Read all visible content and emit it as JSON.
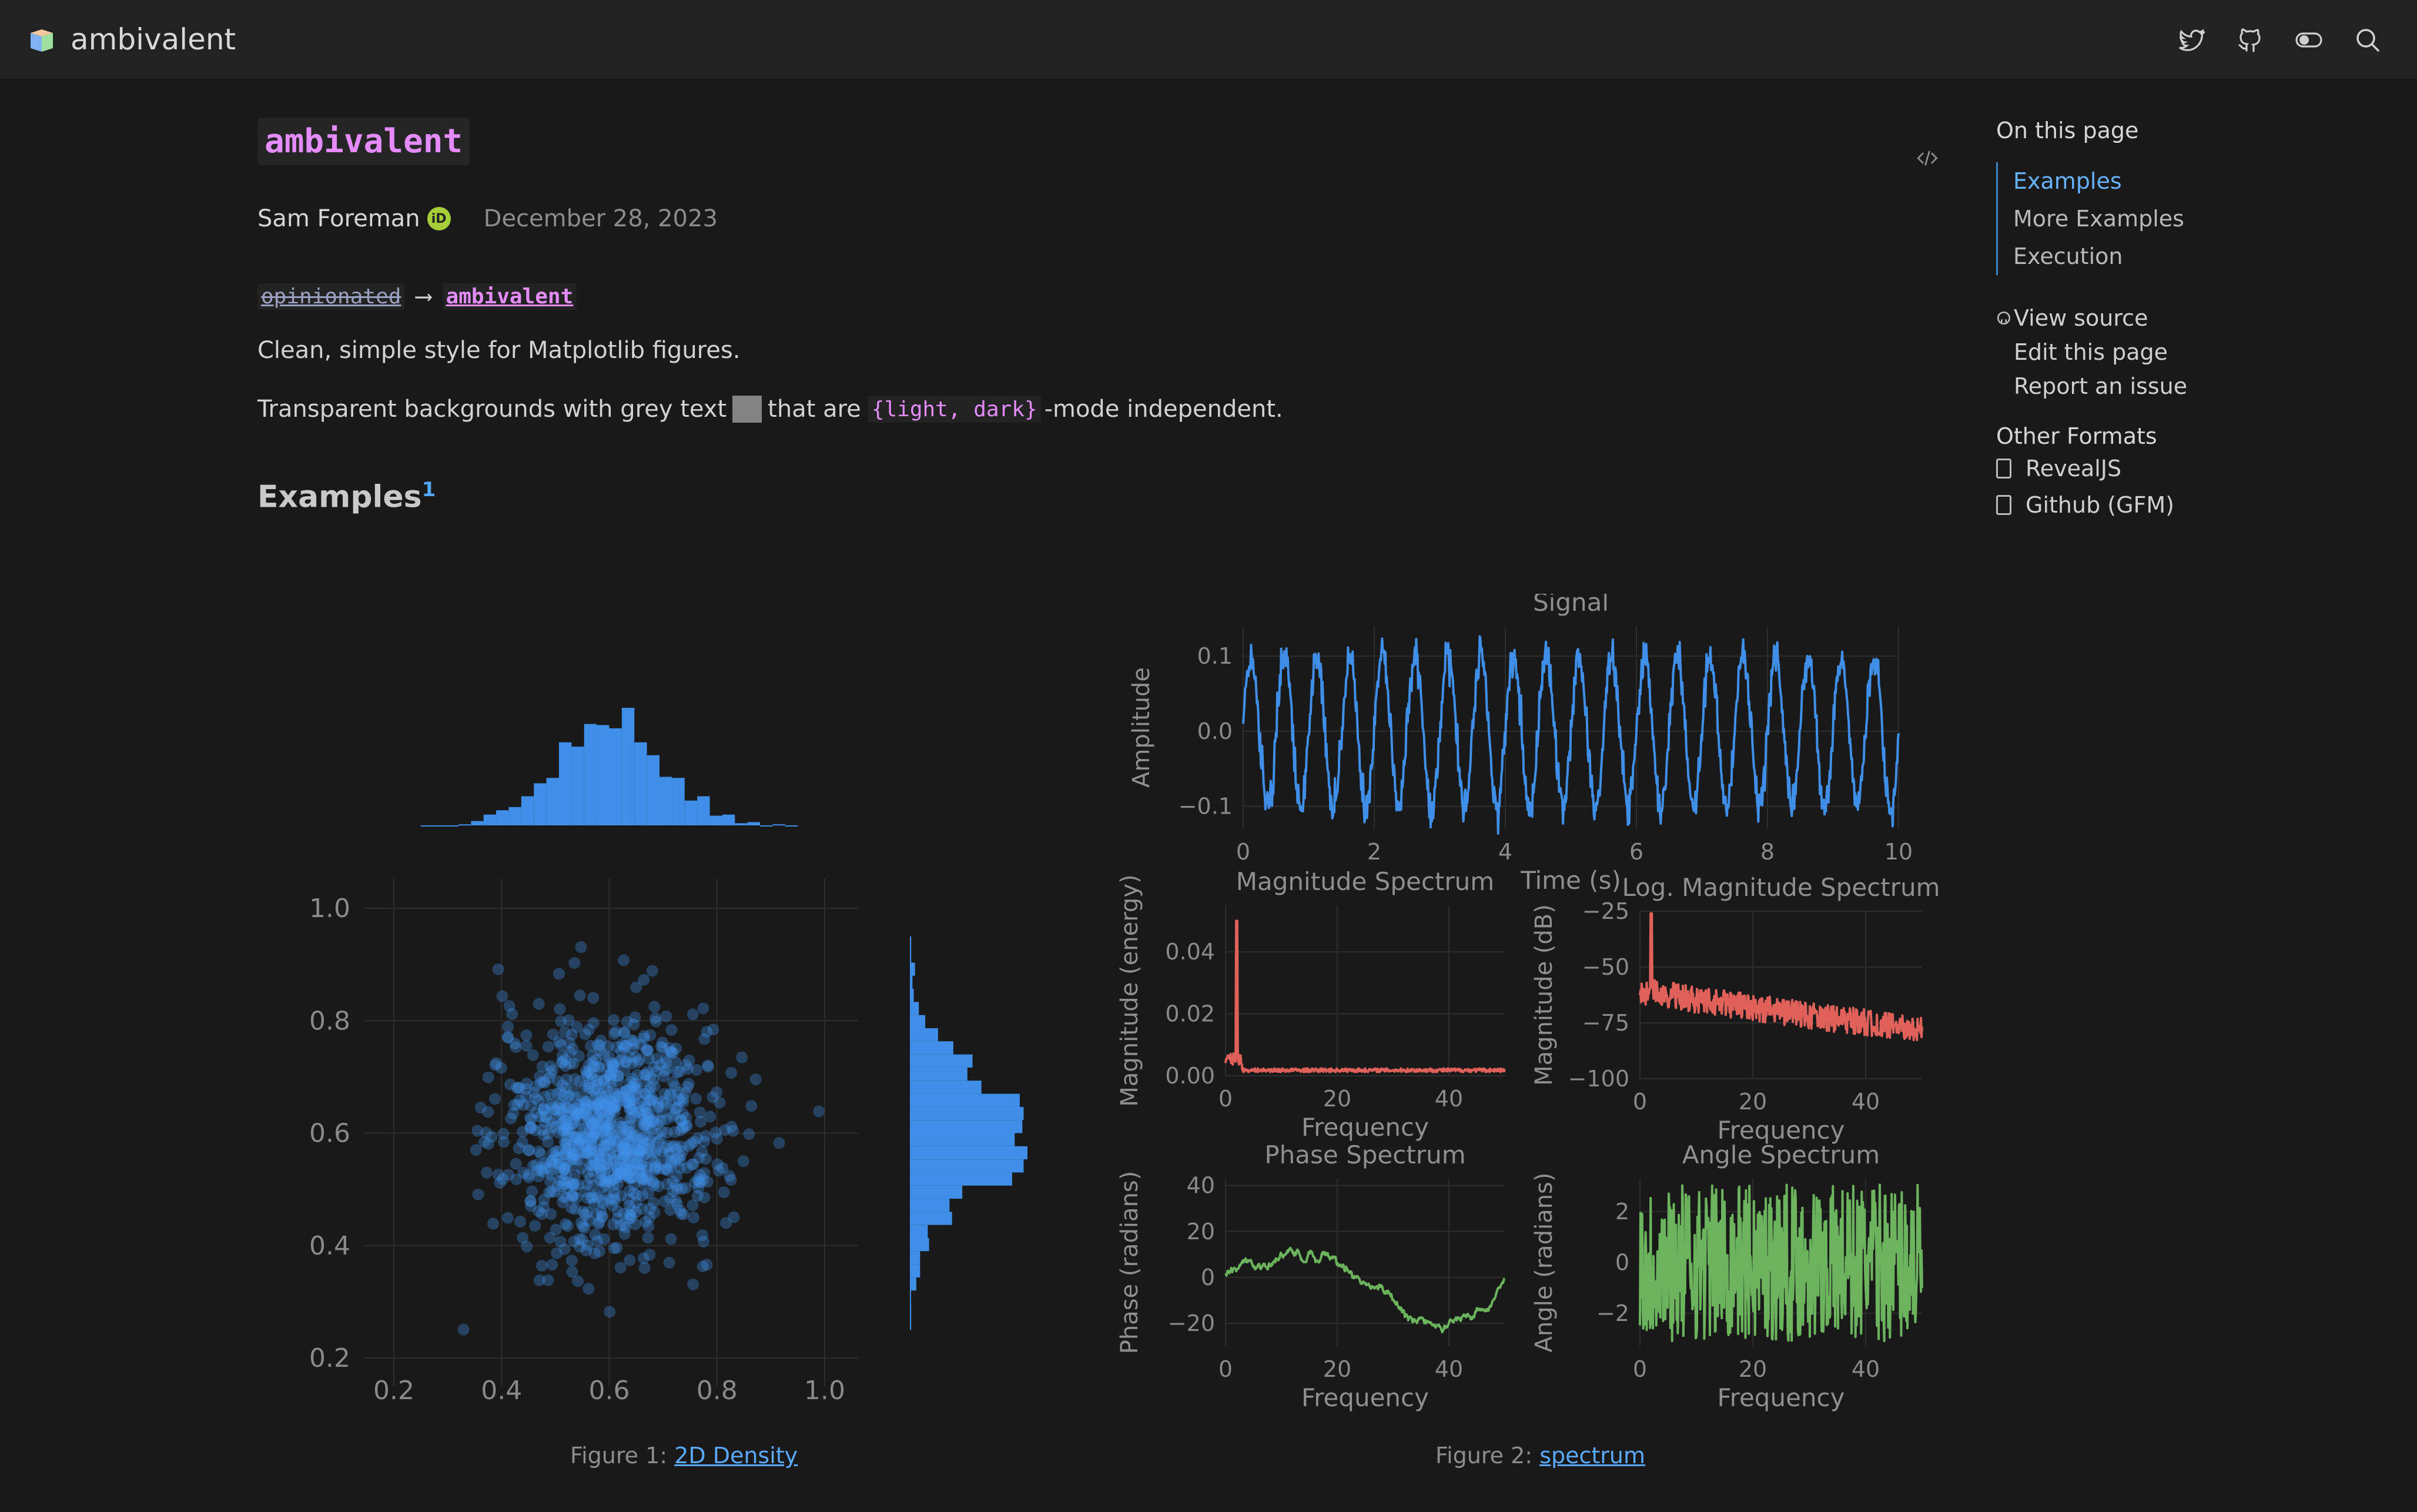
{
  "navbar": {
    "title": "ambivalent",
    "icons": [
      "twitter-icon",
      "github-icon",
      "toggle-icon",
      "search-icon"
    ]
  },
  "page": {
    "title": "ambivalent",
    "author": "Sam Foreman",
    "orcid_badge": "iD",
    "date": "December 28, 2023",
    "tagline_old": "opinionated",
    "tagline_arrow": "⟶",
    "tagline_new": "ambivalent",
    "desc1": "Clean, simple style for Matplotlib figures.",
    "desc2_before": "Transparent backgrounds with grey text",
    "desc2_middle": "that are",
    "desc2_code": "{light, dark}",
    "desc2_after": "-mode independent.",
    "section_title": "Examples",
    "footnote": "1"
  },
  "figures": {
    "fig1_caption_prefix": "Figure 1:",
    "fig1_caption_link": "2D Density",
    "fig2_caption_prefix": "Figure 2:",
    "fig2_caption_link": "spectrum"
  },
  "toc": {
    "heading": "On this page",
    "items": [
      {
        "label": "Examples",
        "active": true
      },
      {
        "label": "More Examples",
        "active": false
      },
      {
        "label": "Execution",
        "active": false
      }
    ],
    "actions": [
      "View source",
      "Edit this page",
      "Report an issue"
    ],
    "formats_heading": "Other Formats",
    "formats": [
      "RevealJS",
      "Github (GFM)"
    ]
  },
  "colors": {
    "background": "#191919",
    "navbar": "#222222",
    "accent_pink": "#e48cff",
    "link_blue": "#5aa9ff",
    "plot_blue": "#3f8ee8",
    "plot_red": "#e0605a",
    "plot_green": "#6bb35c",
    "grey_swatch": "#838383"
  },
  "chart_data": [
    {
      "type": "scatter",
      "name": "2D Density",
      "xlim": [
        0.2,
        1.0
      ],
      "ylim": [
        0.2,
        1.0
      ],
      "xticks": [
        "0.2",
        "0.4",
        "0.6",
        "0.8",
        "1.0"
      ],
      "yticks": [
        "0.2",
        "0.4",
        "0.6",
        "0.8",
        "1.0"
      ],
      "center": [
        0.6,
        0.6
      ],
      "spread_std": 0.1,
      "n_points": 1000,
      "marginals": "histograms on top (x) and right (y)"
    },
    {
      "type": "line",
      "title": "Signal",
      "xlabel": "Time (s)",
      "ylabel": "Amplitude",
      "xticks": [
        "0",
        "2",
        "4",
        "6",
        "8",
        "10"
      ],
      "yticks": [
        "−0.1",
        "0.0",
        "0.1"
      ],
      "xlim": [
        0,
        10
      ],
      "ylim": [
        -0.13,
        0.14
      ],
      "frequency_hz": 2,
      "amplitude": 0.1
    },
    {
      "type": "line",
      "title": "Magnitude Spectrum",
      "xlabel": "Frequency",
      "ylabel": "Magnitude (energy)",
      "xticks": [
        "0",
        "20",
        "40"
      ],
      "yticks": [
        "0.00",
        "0.02",
        "0.04"
      ],
      "xlim": [
        0,
        50
      ],
      "ylim": [
        0,
        0.055
      ],
      "peak": {
        "x": 2,
        "y": 0.05
      },
      "floor": 0.002
    },
    {
      "type": "line",
      "title": "Log. Magnitude Spectrum",
      "xlabel": "Frequency",
      "ylabel": "Magnitude (dB)",
      "xticks": [
        "0",
        "20",
        "40"
      ],
      "yticks": [
        "−25",
        "−50",
        "−75",
        "−100"
      ],
      "xlim": [
        0,
        50
      ],
      "ylim": [
        -100,
        -25
      ],
      "peak": {
        "x": 2,
        "y": -26
      }
    },
    {
      "type": "line",
      "title": "Phase Spectrum",
      "xlabel": "Frequency",
      "ylabel": "Phase (radians)",
      "xticks": [
        "0",
        "20",
        "40"
      ],
      "yticks": [
        "−20",
        "0",
        "20",
        "40"
      ],
      "xlim": [
        0,
        50
      ],
      "ylim": [
        -30,
        43
      ]
    },
    {
      "type": "line",
      "title": "Angle Spectrum",
      "xlabel": "Frequency",
      "ylabel": "Angle (radians)",
      "xticks": [
        "0",
        "20",
        "40"
      ],
      "yticks": [
        "−2",
        "0",
        "2"
      ],
      "xlim": [
        0,
        50
      ],
      "ylim": [
        -3.3,
        3.3
      ]
    }
  ]
}
